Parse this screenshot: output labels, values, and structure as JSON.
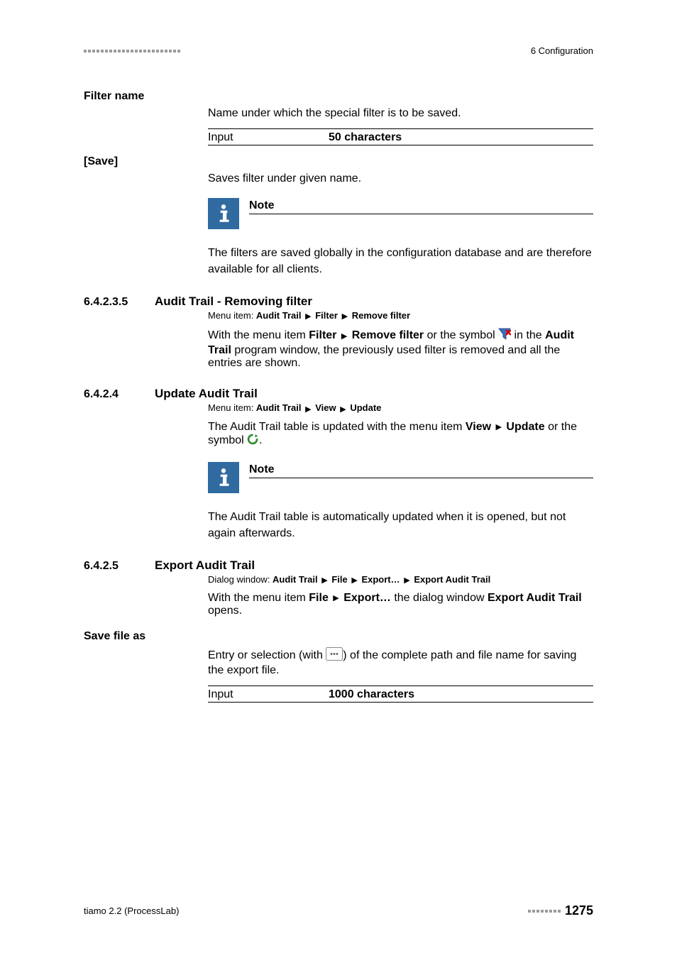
{
  "header": {
    "right": "6 Configuration"
  },
  "s_filter_name": {
    "heading": "Filter name",
    "para": "Name under which the special filter is to be saved.",
    "input_label": "Input",
    "input_value": "50 characters"
  },
  "s_save": {
    "heading": "[Save]",
    "para": "Saves filter under given name.",
    "note_title": "Note",
    "note_body": "The filters are saved globally in the configuration database and are therefore available for all clients."
  },
  "s_remove": {
    "num": "6.4.2.3.5",
    "title": "Audit Trail - Removing filter",
    "menu_prefix": "Menu item: ",
    "menu_b1": "Audit Trail",
    "menu_b2": "Filter",
    "menu_b3": "Remove filter",
    "p_a": "With the menu item ",
    "p_b1": "Filter",
    "p_b2": "Remove filter",
    "p_mid": " or the symbol ",
    "p_c": " in the ",
    "p_d1": "Audit Trail",
    "p_e": " program window, the previously used filter is removed and all the entries are shown."
  },
  "s_update": {
    "num": "6.4.2.4",
    "title": "Update Audit Trail",
    "menu_prefix": "Menu item: ",
    "menu_b1": "Audit Trail",
    "menu_b2": "View",
    "menu_b3": "Update",
    "p_a": "The Audit Trail table is updated with the menu item ",
    "p_b1": "View",
    "p_b2": "Update",
    "p_c": " or the symbol ",
    "p_d": ".",
    "note_title": "Note",
    "note_body": "The Audit Trail table is automatically updated when it is opened, but not again afterwards."
  },
  "s_export": {
    "num": "6.4.2.5",
    "title": "Export Audit Trail",
    "menu_prefix": "Dialog window: ",
    "menu_b1": "Audit Trail",
    "menu_b2": "File",
    "menu_b3": "Export…",
    "menu_b4": "Export Audit Trail",
    "p_a": "With the menu item ",
    "p_b1": "File",
    "p_b2": "Export…",
    "p_c": " the dialog window ",
    "p_d": "Export Audit Trail",
    "p_e": " opens."
  },
  "s_savefile": {
    "heading": "Save file as",
    "p_a": "Entry or selection (with ",
    "p_b": ") of the complete path and file name for saving the export file.",
    "input_label": "Input",
    "input_value": "1000 characters"
  },
  "footer": {
    "left": "tiamo 2.2 (ProcessLab)",
    "page": "1275"
  }
}
